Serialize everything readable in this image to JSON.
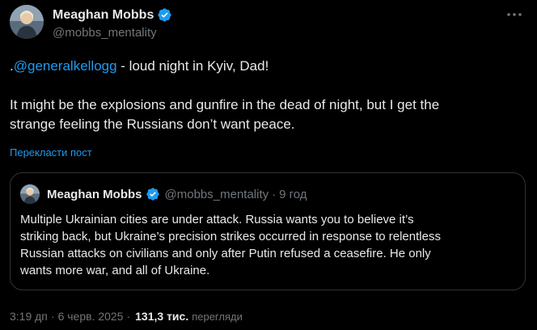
{
  "author": {
    "display_name": "Meaghan Mobbs",
    "handle": "@mobbs_mentality",
    "avatar_icon": "profile-photo"
  },
  "tweet": {
    "prefix": ".",
    "mention": "@generalkellogg",
    "line1_rest": " - loud night in Kyiv, Dad!",
    "para2_line1": "It might be the explosions and gunfire in the dead of night, but I get the",
    "para2_line2": "strange feeling the Russians don’t want peace.",
    "translate_label": "Перекласти пост"
  },
  "quote": {
    "display_name": "Meaghan Mobbs",
    "handle": "@mobbs_mentality",
    "separator": "·",
    "time": "9 год",
    "lines": [
      "Multiple Ukrainian cities are under attack. Russia wants you to believe it’s",
      "striking back, but Ukraine’s precision strikes occurred in response to relentless",
      "Russian attacks on civilians and only after Putin refused a ceasefire. He only",
      "wants more war, and all of Ukraine."
    ]
  },
  "meta": {
    "time": "3:19 дп",
    "separator1": "·",
    "date": "6 черв. 2025",
    "separator2": "·",
    "views_count": "131,3 тис.",
    "views_label": "перегляди"
  },
  "icons": {
    "verified": "verified-badge-icon",
    "more": "more-options-icon"
  },
  "colors": {
    "background": "#000000",
    "text_primary": "#e7e9ea",
    "text_secondary": "#71767b",
    "accent": "#1d9bf0",
    "border": "#2f3336"
  }
}
